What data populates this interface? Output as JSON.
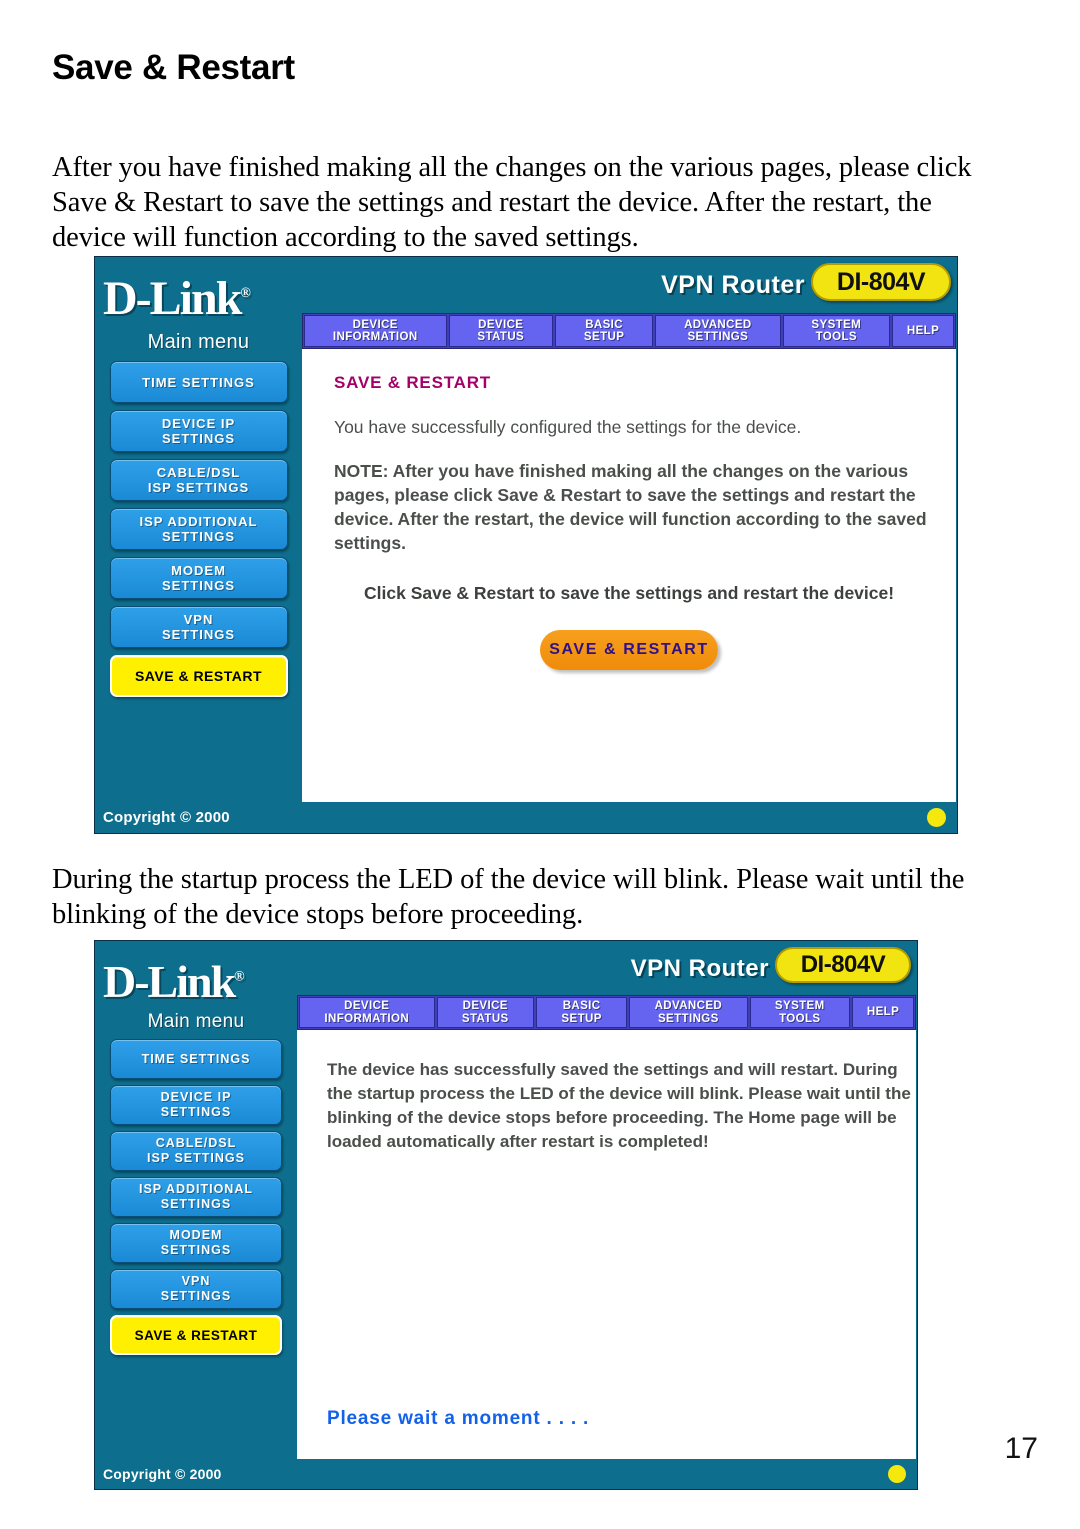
{
  "document": {
    "heading": "Save & Restart",
    "paragraph_1": "After you have finished making all the changes on the various pages, please click Save & Restart to save the settings and restart the device. After the restart, the device will function according to the saved settings.",
    "paragraph_2": "During the startup process the LED of the device will blink. Please wait until the blinking of the device stops before proceeding.",
    "page_number": "17"
  },
  "router_ui": {
    "brand": "D-Link",
    "brand_registered_mark": "®",
    "product_name": "VPN Router",
    "model_badge": "DI-804V",
    "nav_tabs": [
      {
        "label": "DEVICE\nINFORMATION",
        "name": "device-information"
      },
      {
        "label": "DEVICE\nSTATUS",
        "name": "device-status"
      },
      {
        "label": "BASIC\nSETUP",
        "name": "basic-setup"
      },
      {
        "label": "ADVANCED\nSETTINGS",
        "name": "advanced-settings"
      },
      {
        "label": "SYSTEM\nTOOLS",
        "name": "system-tools"
      },
      {
        "label": "HELP",
        "name": "help"
      }
    ],
    "sidebar": {
      "title": "Main menu",
      "items": [
        {
          "label": "TIME SETTINGS",
          "active": false
        },
        {
          "label": "DEVICE IP\nSETTINGS",
          "active": false
        },
        {
          "label": "CABLE/DSL\nISP SETTINGS",
          "active": false
        },
        {
          "label": "ISP ADDITIONAL\nSETTINGS",
          "active": false
        },
        {
          "label": "MODEM\nSETTINGS",
          "active": false
        },
        {
          "label": "VPN\nSETTINGS",
          "active": false
        },
        {
          "label": "SAVE & RESTART",
          "active": true
        }
      ]
    },
    "footer": {
      "copyright": "Copyright © 2000"
    },
    "colors": {
      "header_teal": "#0d6e8d",
      "nav_tab_purple": "#6464f0",
      "sidebar_button_blue": "#2ea0e8",
      "active_button_yellow": "#ffef00",
      "badge_yellow": "#f2e410",
      "title_magenta": "#a4006b",
      "save_button_orange": "#f7a01e",
      "save_button_text": "#30108a",
      "wait_text_blue": "#1361e8",
      "led_yellow": "#f4e80c"
    }
  },
  "screen_1": {
    "title": "SAVE & RESTART",
    "success_line": "You have successfully configured the settings for the device.",
    "note": "NOTE: After you have finished making all the changes on the various pages, please click Save & Restart to save the settings and restart the device. After the restart, the device will function according to the saved settings.",
    "cta": "Click Save & Restart to save the settings and restart the device!",
    "button_label": "SAVE & RESTART"
  },
  "screen_2": {
    "body": "The device has successfully saved the settings and will restart. During the startup process the LED of the device will blink. Please wait until the blinking of the device stops before proceeding. The Home page will be loaded automatically after restart is completed!",
    "wait_message": "Please wait a moment . . . ."
  }
}
